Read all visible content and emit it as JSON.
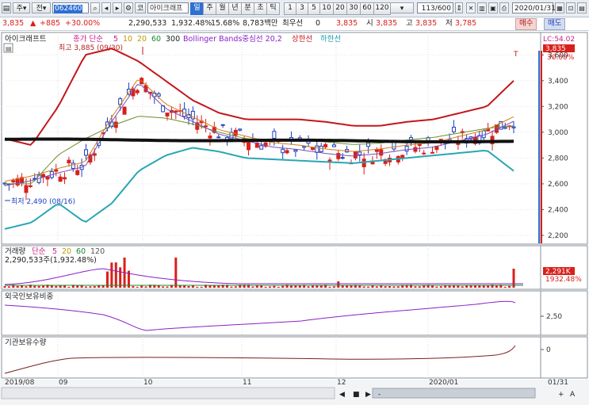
{
  "toolbar": {
    "market_label": "주",
    "type_label": "전",
    "stock_code": "062460",
    "stock_name_button": "코",
    "stock_name": "아이크래프",
    "periods": [
      "일",
      "주",
      "월",
      "년",
      "분",
      "초",
      "틱"
    ],
    "selected_period": "일",
    "intervals": [
      "1",
      "3",
      "5",
      "10",
      "20",
      "30",
      "60",
      "120"
    ],
    "count": "113/600",
    "date": "2020/01/31"
  },
  "quote": {
    "price": "3,835",
    "change": "+885",
    "change_pct": "+30.00%",
    "volume": "2,290,533",
    "volume_ratio": "1,932.48%",
    "turnover": "15.68%",
    "trade_amount": "8,783백만",
    "extra_label": "최우선",
    "extra_value": "0",
    "price2": "3,835",
    "open_label": "시",
    "open": "3,835",
    "high_label": "고",
    "high": "3,835",
    "low_label": "저",
    "low": "3,785",
    "buy_label": "매수",
    "sell_label": "매도",
    "up_arrow": "▲"
  },
  "price_panel": {
    "stock_label": "아이크래프트",
    "ma_label": "종가 단순",
    "ma_periods": [
      "5",
      "10",
      "20",
      "60",
      "300"
    ],
    "bb_label": "Bollinger Bands중심선 20,2",
    "bb_upper": "상한선",
    "bb_lower": "하한선",
    "hi_annotation": "최고 3,885 (09/30)",
    "lo_annotation": "최저 2,490 (08/16)",
    "lc_label": "LC:54.02",
    "cur_price_tag": "3,835",
    "cur_pct_tag": "30.00%",
    "marker_t": "T",
    "y_ticks": [
      "3,600",
      "3,400",
      "3,200",
      "3,000",
      "2,800",
      "2,600",
      "2,400",
      "2,200"
    ]
  },
  "volume_panel": {
    "label": "거래량",
    "ma_label": "단순",
    "ma_periods": [
      "5",
      "20",
      "60",
      "120"
    ],
    "value_label": "2,290,533주(1,932.48%)",
    "tag_value": "2,291K",
    "tag_pct": "1932.48%"
  },
  "foreign_panel": {
    "label": "외국인보유비중",
    "y_tick": "2,50"
  },
  "inst_panel": {
    "label": "기관보유수량",
    "y_tick": "0"
  },
  "x_axis": {
    "labels": [
      "2019/08",
      "09",
      "10",
      "11",
      "12",
      "2020/01"
    ],
    "right_label": "01/31",
    "controls": [
      "◀",
      "■",
      "▶",
      "-",
      "+",
      "A"
    ]
  },
  "colors": {
    "up": "#d8201b",
    "down": "#1d3fbf",
    "accent": "#2f6fd1"
  },
  "icons": {
    "settings": "gear-icon",
    "print": "print-icon",
    "save": "save-icon",
    "lock": "lock-icon",
    "search": "search-icon"
  },
  "chart_data": {
    "type": "candlestick",
    "x_range": [
      "2019/08",
      "2020/01/31"
    ],
    "ylim": [
      2200,
      3700
    ],
    "y_ticks": [
      2200,
      2400,
      2600,
      2800,
      3000,
      3200,
      3400,
      3600
    ],
    "grid": true,
    "series": [
      {
        "name": "종가 단순 5",
        "values": [
          2600,
          2640,
          2700,
          2750,
          3100,
          3400,
          3200,
          3100,
          3000,
          2950,
          2900,
          2880,
          2850,
          2830,
          2850,
          2880,
          2900,
          2950,
          3000,
          3100
        ]
      },
      {
        "name": "상한선",
        "values": [
          2950,
          2900,
          3200,
          3600,
          3650,
          3550,
          3400,
          3250,
          3150,
          3100,
          3100,
          3100,
          3080,
          3050,
          3050,
          3080,
          3100,
          3150,
          3200,
          3400
        ]
      },
      {
        "name": "하한선",
        "values": [
          2250,
          2300,
          2450,
          2300,
          2450,
          2700,
          2820,
          2880,
          2850,
          2800,
          2790,
          2780,
          2770,
          2760,
          2780,
          2800,
          2820,
          2840,
          2860,
          2700
        ]
      }
    ],
    "annotations": [
      {
        "label": "최고 3,885 (09/30)",
        "value": 3885
      },
      {
        "label": "최저 2,490 (08/16)",
        "value": 2490
      }
    ],
    "last_close": 3835,
    "last_change_pct": 30.0
  }
}
